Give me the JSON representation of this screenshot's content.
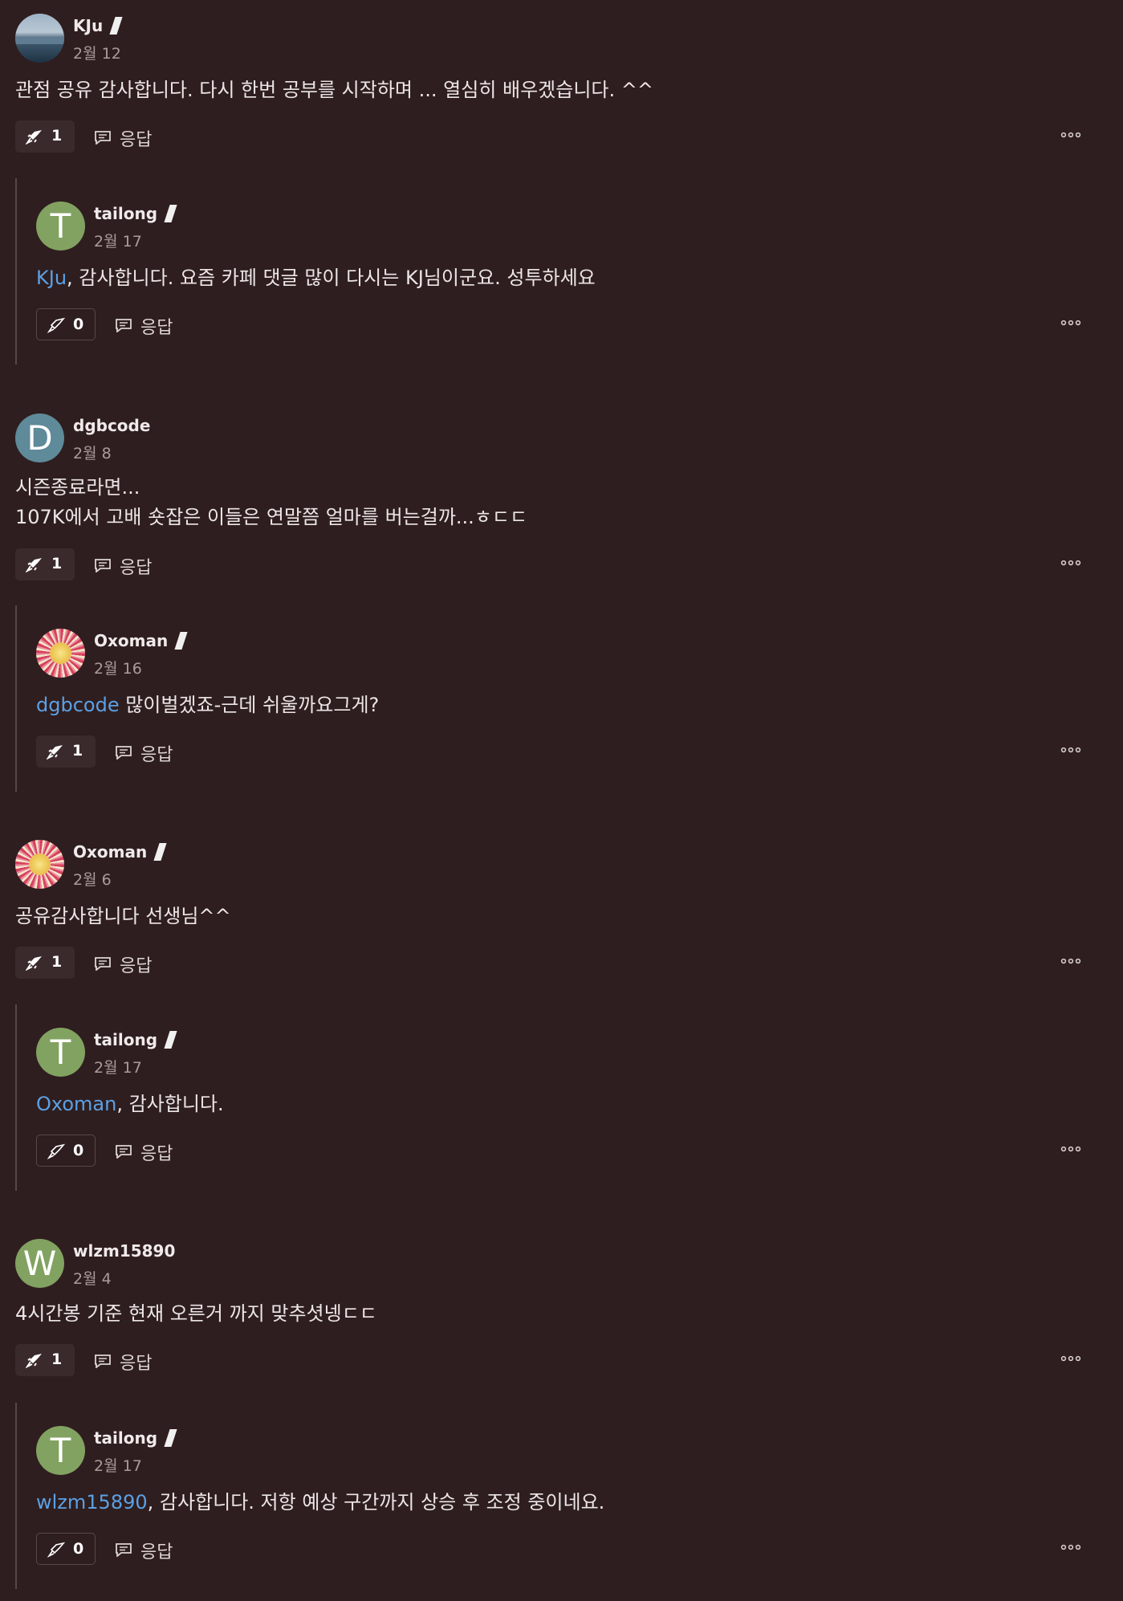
{
  "reply_label": "응답",
  "colors": {
    "background": "#2f1e1f",
    "mention": "#5ba0e4",
    "button_bg": "#3b2a2b"
  },
  "icons": {
    "like": "rocket-icon",
    "reply": "comment-icon",
    "more": "more-options-icon",
    "author_badge": "pen-icon"
  },
  "threads": [
    {
      "comment": {
        "author": "KJu",
        "date": "2월 12",
        "text": "관점 공유 감사합니다. 다시 한번 공부를 시작하며 ... 열심히 배우겠습니다. ^^",
        "likes": "1"
      },
      "reply": {
        "author": "tailong",
        "date": "2월 17",
        "mention": "KJu",
        "text": ", 감사합니다. 요즘 카페 댓글 많이 다시는 KJ님이군요. 성투하세요",
        "likes": "0"
      }
    },
    {
      "comment": {
        "author": "dgbcode",
        "date": "2월 8",
        "text_line1": "시즌종료라면...",
        "text_line2": "107K에서 고배 숏잡은 이들은 연말쯤 얼마를 버는걸까...ㅎㄷㄷ",
        "likes": "1"
      },
      "reply": {
        "author": "Oxoman",
        "date": "2월 16",
        "mention": "dgbcode",
        "text": " 많이벌겠죠-근데 쉬울까요그게?",
        "likes": "1"
      }
    },
    {
      "comment": {
        "author": "Oxoman",
        "date": "2월 6",
        "text": "공유감사합니다 선생님^^",
        "likes": "1"
      },
      "reply": {
        "author": "tailong",
        "date": "2월 17",
        "mention": "Oxoman",
        "text": ", 감사합니다.",
        "likes": "0"
      }
    },
    {
      "comment": {
        "author": "wlzm15890",
        "date": "2월 4",
        "text": "4시간봉 기준 현재 오른거 까지 맞추셧넹ㄷㄷ",
        "likes": "1"
      },
      "reply": {
        "author": "tailong",
        "date": "2월 17",
        "mention": "wlzm15890",
        "text": ", 감사합니다. 저항 예상 구간까지 상승 후 조정 중이네요.",
        "likes": "0"
      }
    }
  ]
}
